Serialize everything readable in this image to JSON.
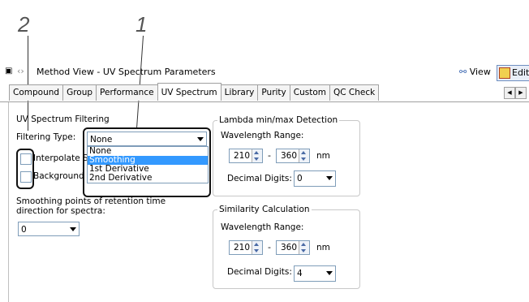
{
  "callouts": {
    "c1": "1",
    "c2": "2"
  },
  "window": {
    "title": "Method View - UV Spectrum Parameters",
    "view_label": "View",
    "edit_label": "Edit"
  },
  "tabs": [
    {
      "label": "Compound"
    },
    {
      "label": "Group"
    },
    {
      "label": "Performance"
    },
    {
      "label": "UV Spectrum"
    },
    {
      "label": "Library"
    },
    {
      "label": "Purity"
    },
    {
      "label": "Custom"
    },
    {
      "label": "QC Check"
    }
  ],
  "uv_filtering": {
    "group_label": "UV Spectrum Filtering",
    "filtering_type_label": "Filtering Type:",
    "filtering_type_value": "None",
    "options": [
      "None",
      "Smoothing",
      "1st Derivative",
      "2nd Derivative"
    ],
    "selected_option": "Smoothing",
    "interpolate_label": "Interpolate S",
    "background_label": "Background",
    "smoothing_points_label": "Smoothing points of retention time direction for spectra:",
    "smoothing_points_value": "0"
  },
  "lambda": {
    "group_label": "Lambda min/max Detection",
    "range_label": "Wavelength Range:",
    "min": "210",
    "sep": "-",
    "max": "360",
    "unit": "nm",
    "digits_label": "Decimal Digits:",
    "digits_value": "0"
  },
  "similarity": {
    "group_label": "Similarity Calculation",
    "range_label": "Wavelength Range:",
    "min": "210",
    "sep": "-",
    "max": "360",
    "unit": "nm",
    "digits_label": "Decimal Digits:",
    "digits_value": "4"
  },
  "colors": {
    "selection": "#3399ff",
    "border": "#7f9db9"
  }
}
